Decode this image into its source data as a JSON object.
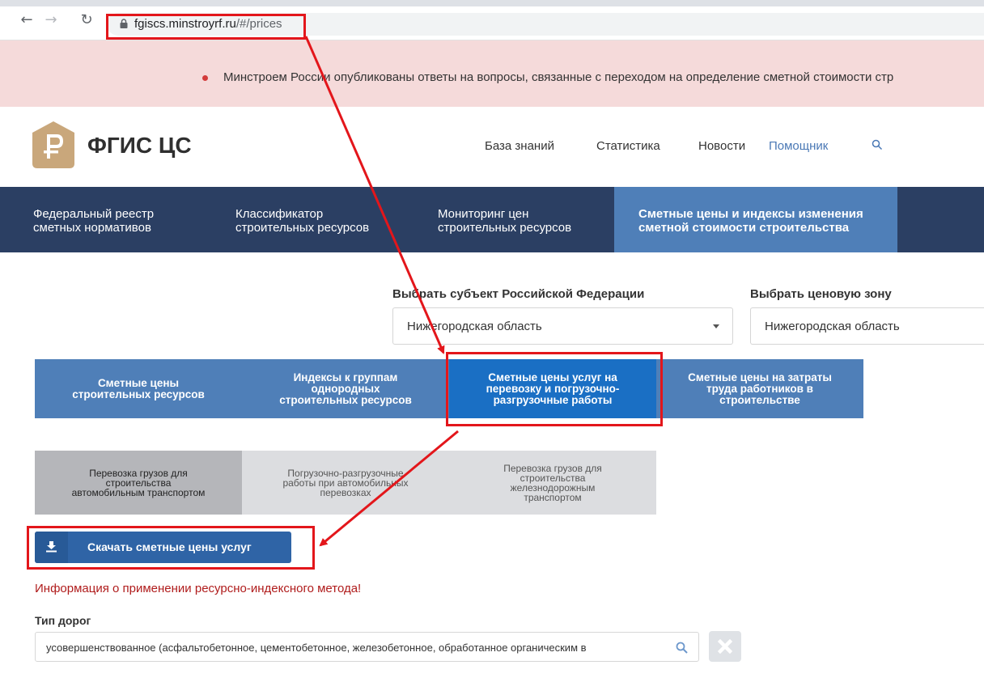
{
  "browser": {
    "back_icon": "arrow-left-icon",
    "forward_icon": "arrow-right-icon",
    "reload_icon": "reload-icon",
    "url_host": "fgiscs.minstroyrf.ru",
    "url_path": "/#/prices"
  },
  "alert": {
    "text": "Минстроем России опубликованы ответы на вопросы, связанные с переходом на определение сметной стоимости стр"
  },
  "header": {
    "brand": "ФГИС ЦС",
    "nav": [
      "База знаний",
      "Статистика",
      "Новости",
      "Помощник"
    ]
  },
  "menu": [
    {
      "line1": "Федеральный реестр",
      "line2": "сметных нормативов"
    },
    {
      "line1": "Классификатор",
      "line2": "строительных ресурсов"
    },
    {
      "line1": "Мониторинг цен",
      "line2": "строительных ресурсов"
    },
    {
      "line1": "Сметные цены и индексы изменения",
      "line2": "сметной стоимости строительства"
    }
  ],
  "selectors": {
    "subject_label": "Выбрать субъект Российской Федерации",
    "subject_value": "Нижегородская область",
    "zone_label": "Выбрать ценовую зону",
    "zone_value": "Нижегородская область"
  },
  "tabs_level1": [
    {
      "l1": "Сметные цены",
      "l2": "строительных ресурсов",
      "l3": ""
    },
    {
      "l1": "Индексы к группам",
      "l2": "однородных",
      "l3": "строительных ресурсов"
    },
    {
      "l1": "Сметные цены услуг на",
      "l2": "перевозку и погрузочно-",
      "l3": "разгрузочные работы"
    },
    {
      "l1": "Сметные цены на затраты",
      "l2": "труда работников в",
      "l3": "строительстве"
    }
  ],
  "tabs_level2": [
    {
      "l1": "Перевозка грузов для",
      "l2": "строительства",
      "l3": "автомобильным транспортом",
      "l4": ""
    },
    {
      "l1": "Погрузочно-разгрузочные",
      "l2": "работы при автомобильных",
      "l3": "перевозках",
      "l4": ""
    },
    {
      "l1": "Перевозка грузов для",
      "l2": "строительства",
      "l3": "железнодорожным",
      "l4": "транспортом"
    }
  ],
  "download_button": "Скачать сметные цены услуг",
  "info_link": "Информация о применении ресурсно-индексного метода!",
  "road_type": {
    "label": "Тип дорог",
    "value": "усовершенствованное (асфальтобетонное, цементобетонное, железобетонное, обработанное органическим в"
  },
  "colors": {
    "menu_bg": "#2b3f63",
    "menu_active": "#4f7fb8",
    "tab_active": "#1a6fc4",
    "annotation": "#e3161b",
    "alert_bg": "#f5dada"
  }
}
